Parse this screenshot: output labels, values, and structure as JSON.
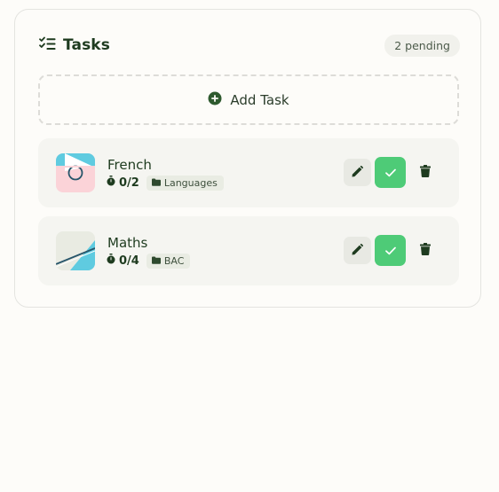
{
  "header": {
    "title": "Tasks",
    "title_icon": "checklist-icon",
    "pending_badge": "2 pending"
  },
  "add_task": {
    "label": "Add Task",
    "icon": "plus-circle-icon"
  },
  "tasks": [
    {
      "name": "French",
      "progress": "0/2",
      "category": "Languages",
      "progress_icon": "stopwatch-icon",
      "category_icon": "folder-icon"
    },
    {
      "name": "Maths",
      "progress": "0/4",
      "category": "BAC",
      "progress_icon": "stopwatch-icon",
      "category_icon": "folder-icon"
    }
  ],
  "actions": {
    "edit_icon": "pencil-icon",
    "complete_icon": "check-icon",
    "delete_icon": "trash-icon"
  },
  "colors": {
    "accent_green": "#4ecb77",
    "text_dark_green": "#1e3b1f",
    "background": "#fdfcf9"
  }
}
